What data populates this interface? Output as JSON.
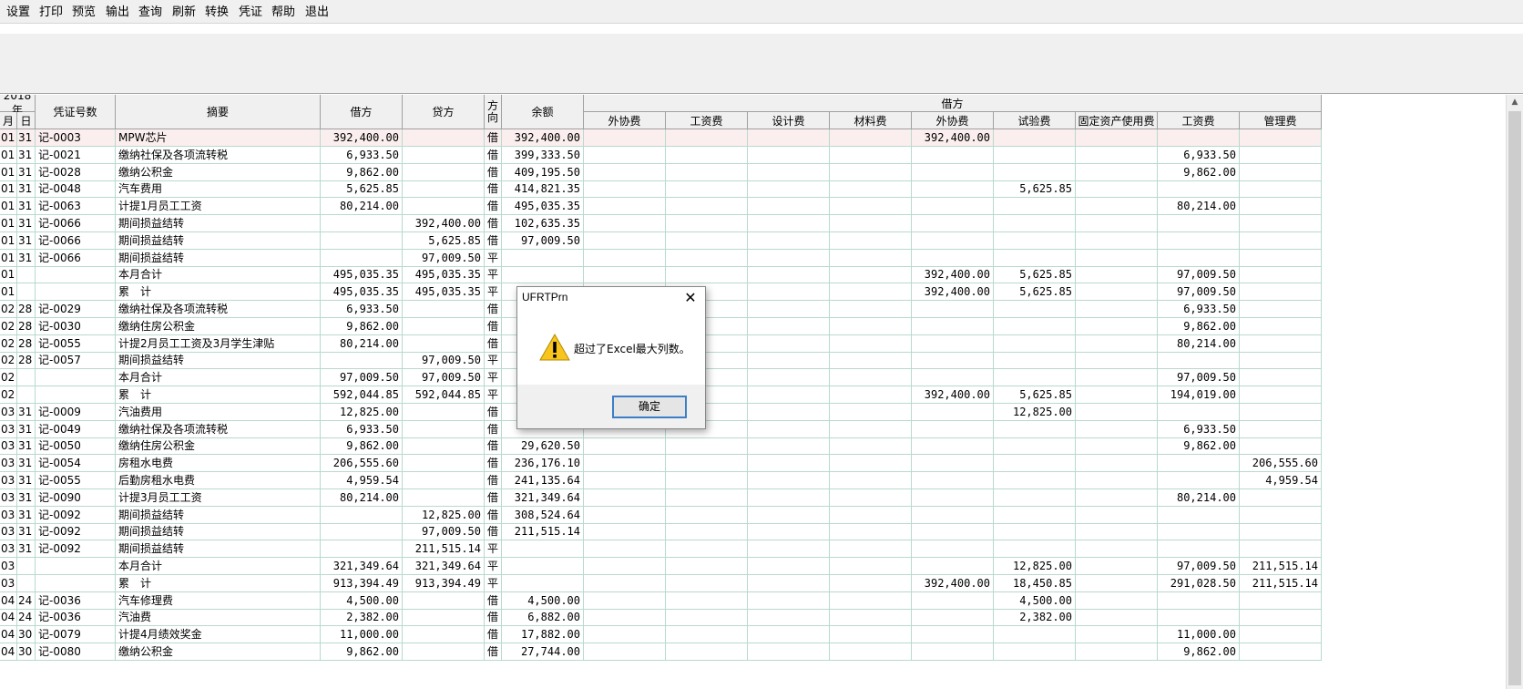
{
  "toolbar": {
    "items": [
      "设置",
      "打印",
      "预览",
      "输出",
      "查询",
      "刷新",
      "转换",
      "凭证",
      "帮助",
      "退出"
    ]
  },
  "header": {
    "year": "2018年",
    "month": "月",
    "day": "日",
    "voucher": "凭证号数",
    "summary": "摘要",
    "debit": "借方",
    "credit": "贷方",
    "direction": "方向",
    "balance": "余额",
    "group_debit": "借方",
    "subcolumns": [
      "外协费",
      "工资费",
      "设计费",
      "材料费",
      "外协费",
      "试验费",
      "固定资产使用费",
      "工资费",
      "管理费"
    ]
  },
  "rows": [
    [
      "01",
      "31",
      "记-0003",
      "MPW芯片",
      "392,400.00",
      "",
      "借",
      "392,400.00",
      "",
      "",
      "",
      "",
      "392,400.00",
      "",
      "",
      "",
      ""
    ],
    [
      "01",
      "31",
      "记-0021",
      "缴纳社保及各项流转税",
      "6,933.50",
      "",
      "借",
      "399,333.50",
      "",
      "",
      "",
      "",
      "",
      "",
      "",
      "6,933.50",
      ""
    ],
    [
      "01",
      "31",
      "记-0028",
      "缴纳公积金",
      "9,862.00",
      "",
      "借",
      "409,195.50",
      "",
      "",
      "",
      "",
      "",
      "",
      "",
      "9,862.00",
      ""
    ],
    [
      "01",
      "31",
      "记-0048",
      "汽车费用",
      "5,625.85",
      "",
      "借",
      "414,821.35",
      "",
      "",
      "",
      "",
      "",
      "5,625.85",
      "",
      "",
      ""
    ],
    [
      "01",
      "31",
      "记-0063",
      "计提1月员工工资",
      "80,214.00",
      "",
      "借",
      "495,035.35",
      "",
      "",
      "",
      "",
      "",
      "",
      "",
      "80,214.00",
      ""
    ],
    [
      "01",
      "31",
      "记-0066",
      "期间损益结转",
      "",
      "392,400.00",
      "借",
      "102,635.35",
      "",
      "",
      "",
      "",
      "",
      "",
      "",
      "",
      ""
    ],
    [
      "01",
      "31",
      "记-0066",
      "期间损益结转",
      "",
      "5,625.85",
      "借",
      "97,009.50",
      "",
      "",
      "",
      "",
      "",
      "",
      "",
      "",
      ""
    ],
    [
      "01",
      "31",
      "记-0066",
      "期间损益结转",
      "",
      "97,009.50",
      "平",
      "",
      "",
      "",
      "",
      "",
      "",
      "",
      "",
      "",
      ""
    ],
    [
      "01",
      "",
      "",
      "本月合计",
      "495,035.35",
      "495,035.35",
      "平",
      "",
      "",
      "",
      "",
      "",
      "392,400.00",
      "5,625.85",
      "",
      "97,009.50",
      ""
    ],
    [
      "01",
      "",
      "",
      "累　计",
      "495,035.35",
      "495,035.35",
      "平",
      "",
      "",
      "",
      "",
      "",
      "392,400.00",
      "5,625.85",
      "",
      "97,009.50",
      ""
    ],
    [
      "02",
      "28",
      "记-0029",
      "缴纳社保及各项流转税",
      "6,933.50",
      "",
      "借",
      "",
      "",
      "",
      "",
      "",
      "",
      "",
      "",
      "6,933.50",
      ""
    ],
    [
      "02",
      "28",
      "记-0030",
      "缴纳住房公积金",
      "9,862.00",
      "",
      "借",
      "",
      "",
      "",
      "",
      "",
      "",
      "",
      "",
      "9,862.00",
      ""
    ],
    [
      "02",
      "28",
      "记-0055",
      "计提2月员工工资及3月学生津贴",
      "80,214.00",
      "",
      "借",
      "",
      "",
      "",
      "",
      "",
      "",
      "",
      "",
      "80,214.00",
      ""
    ],
    [
      "02",
      "28",
      "记-0057",
      "期间损益结转",
      "",
      "97,009.50",
      "平",
      "",
      "",
      "",
      "",
      "",
      "",
      "",
      "",
      "",
      ""
    ],
    [
      "02",
      "",
      "",
      "本月合计",
      "97,009.50",
      "97,009.50",
      "平",
      "",
      "",
      "",
      "",
      "",
      "",
      "",
      "",
      "97,009.50",
      ""
    ],
    [
      "02",
      "",
      "",
      "累　计",
      "592,044.85",
      "592,044.85",
      "平",
      "",
      "",
      "",
      "",
      "",
      "392,400.00",
      "5,625.85",
      "",
      "194,019.00",
      ""
    ],
    [
      "03",
      "31",
      "记-0009",
      "汽油费用",
      "12,825.00",
      "",
      "借",
      "",
      "",
      "",
      "",
      "",
      "",
      "12,825.00",
      "",
      "",
      ""
    ],
    [
      "03",
      "31",
      "记-0049",
      "缴纳社保及各项流转税",
      "6,933.50",
      "",
      "借",
      "",
      "",
      "",
      "",
      "",
      "",
      "",
      "",
      "6,933.50",
      ""
    ],
    [
      "03",
      "31",
      "记-0050",
      "缴纳住房公积金",
      "9,862.00",
      "",
      "借",
      "29,620.50",
      "",
      "",
      "",
      "",
      "",
      "",
      "",
      "9,862.00",
      ""
    ],
    [
      "03",
      "31",
      "记-0054",
      "房租水电费",
      "206,555.60",
      "",
      "借",
      "236,176.10",
      "",
      "",
      "",
      "",
      "",
      "",
      "",
      "",
      "206,555.60"
    ],
    [
      "03",
      "31",
      "记-0055",
      "后勤房租水电费",
      "4,959.54",
      "",
      "借",
      "241,135.64",
      "",
      "",
      "",
      "",
      "",
      "",
      "",
      "",
      "4,959.54"
    ],
    [
      "03",
      "31",
      "记-0090",
      "计提3月员工工资",
      "80,214.00",
      "",
      "借",
      "321,349.64",
      "",
      "",
      "",
      "",
      "",
      "",
      "",
      "80,214.00",
      ""
    ],
    [
      "03",
      "31",
      "记-0092",
      "期间损益结转",
      "",
      "12,825.00",
      "借",
      "308,524.64",
      "",
      "",
      "",
      "",
      "",
      "",
      "",
      "",
      ""
    ],
    [
      "03",
      "31",
      "记-0092",
      "期间损益结转",
      "",
      "97,009.50",
      "借",
      "211,515.14",
      "",
      "",
      "",
      "",
      "",
      "",
      "",
      "",
      ""
    ],
    [
      "03",
      "31",
      "记-0092",
      "期间损益结转",
      "",
      "211,515.14",
      "平",
      "",
      "",
      "",
      "",
      "",
      "",
      "",
      "",
      "",
      ""
    ],
    [
      "03",
      "",
      "",
      "本月合计",
      "321,349.64",
      "321,349.64",
      "平",
      "",
      "",
      "",
      "",
      "",
      "",
      "12,825.00",
      "",
      "97,009.50",
      "211,515.14"
    ],
    [
      "03",
      "",
      "",
      "累　计",
      "913,394.49",
      "913,394.49",
      "平",
      "",
      "",
      "",
      "",
      "",
      "392,400.00",
      "18,450.85",
      "",
      "291,028.50",
      "211,515.14"
    ],
    [
      "04",
      "24",
      "记-0036",
      "汽车修理费",
      "4,500.00",
      "",
      "借",
      "4,500.00",
      "",
      "",
      "",
      "",
      "",
      "4,500.00",
      "",
      "",
      ""
    ],
    [
      "04",
      "24",
      "记-0036",
      "汽油费",
      "2,382.00",
      "",
      "借",
      "6,882.00",
      "",
      "",
      "",
      "",
      "",
      "2,382.00",
      "",
      "",
      ""
    ],
    [
      "04",
      "30",
      "记-0079",
      "计提4月绩效奖金",
      "11,000.00",
      "",
      "借",
      "17,882.00",
      "",
      "",
      "",
      "",
      "",
      "",
      "",
      "11,000.00",
      ""
    ],
    [
      "04",
      "30",
      "记-0080",
      "缴纳公积金",
      "9,862.00",
      "",
      "借",
      "27,744.00",
      "",
      "",
      "",
      "",
      "",
      "",
      "",
      "9,862.00",
      ""
    ]
  ],
  "dialog": {
    "title": "UFRTPrn",
    "message": "超过了Excel最大列数。",
    "ok_label": "确定",
    "close_glyph": "✕",
    "icon": "warning-icon"
  },
  "scroll_up_glyph": "▲"
}
